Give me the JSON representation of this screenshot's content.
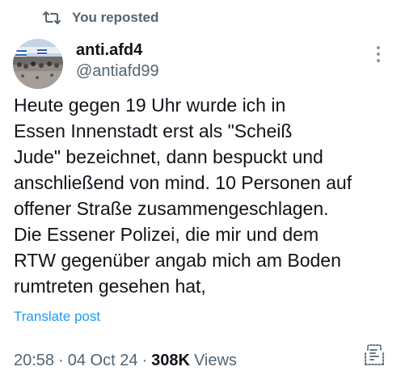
{
  "repost": {
    "text": "You reposted",
    "icon": "repost-icon"
  },
  "author": {
    "display_name": "anti.afd4",
    "handle": "@antiafd99",
    "avatar_icon": "avatar-photo"
  },
  "tweet": {
    "text": "Heute gegen 19 Uhr wurde ich in\nEssen Innenstadt erst als \"Scheiß\nJude\" bezeichnet, dann bespuckt und\nanschließend von mind. 10 Personen auf\noffener Straße zusammengeschlagen.\nDie Essener Polizei, die mir und dem\nRTW gegenüber angab mich am Boden\nrumtreten gesehen hat,",
    "translate_label": "Translate post"
  },
  "meta": {
    "time": "20:58",
    "separator": "·",
    "date": "04 Oct 24",
    "views_count": "308K",
    "views_label": "Views"
  },
  "icons": {
    "more": "more-options-icon",
    "analytics": "analytics-icon"
  },
  "colors": {
    "text_primary": "#0f1419",
    "text_secondary": "#536471",
    "link": "#1d9bf0"
  }
}
